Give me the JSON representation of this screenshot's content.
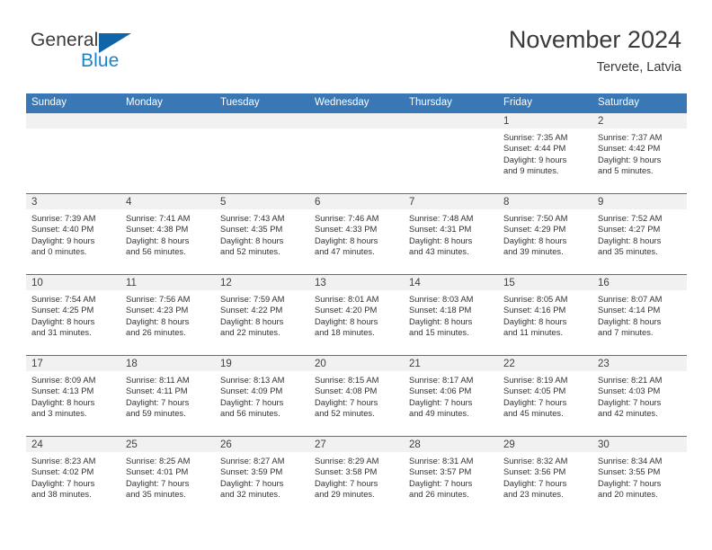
{
  "brand": {
    "word1": "General",
    "word2": "Blue",
    "triangle_icon": "brand-triangle-icon",
    "colors": {
      "word1": "#3c3c3c",
      "word2": "#1b84c9",
      "triangle": "#1064a8"
    }
  },
  "header": {
    "title": "November 2024",
    "subtitle": "Tervete, Latvia"
  },
  "colors": {
    "header_blue": "#3a77b5",
    "daynum_strip": "#f1f1f1",
    "text": "#333333"
  },
  "weekday_headers": [
    "Sunday",
    "Monday",
    "Tuesday",
    "Wednesday",
    "Thursday",
    "Friday",
    "Saturday"
  ],
  "weeks": [
    [
      {
        "day": "",
        "lines": []
      },
      {
        "day": "",
        "lines": []
      },
      {
        "day": "",
        "lines": []
      },
      {
        "day": "",
        "lines": []
      },
      {
        "day": "",
        "lines": []
      },
      {
        "day": "1",
        "lines": [
          "Sunrise: 7:35 AM",
          "Sunset: 4:44 PM",
          "Daylight: 9 hours",
          "and 9 minutes."
        ]
      },
      {
        "day": "2",
        "lines": [
          "Sunrise: 7:37 AM",
          "Sunset: 4:42 PM",
          "Daylight: 9 hours",
          "and 5 minutes."
        ]
      }
    ],
    [
      {
        "day": "3",
        "lines": [
          "Sunrise: 7:39 AM",
          "Sunset: 4:40 PM",
          "Daylight: 9 hours",
          "and 0 minutes."
        ]
      },
      {
        "day": "4",
        "lines": [
          "Sunrise: 7:41 AM",
          "Sunset: 4:38 PM",
          "Daylight: 8 hours",
          "and 56 minutes."
        ]
      },
      {
        "day": "5",
        "lines": [
          "Sunrise: 7:43 AM",
          "Sunset: 4:35 PM",
          "Daylight: 8 hours",
          "and 52 minutes."
        ]
      },
      {
        "day": "6",
        "lines": [
          "Sunrise: 7:46 AM",
          "Sunset: 4:33 PM",
          "Daylight: 8 hours",
          "and 47 minutes."
        ]
      },
      {
        "day": "7",
        "lines": [
          "Sunrise: 7:48 AM",
          "Sunset: 4:31 PM",
          "Daylight: 8 hours",
          "and 43 minutes."
        ]
      },
      {
        "day": "8",
        "lines": [
          "Sunrise: 7:50 AM",
          "Sunset: 4:29 PM",
          "Daylight: 8 hours",
          "and 39 minutes."
        ]
      },
      {
        "day": "9",
        "lines": [
          "Sunrise: 7:52 AM",
          "Sunset: 4:27 PM",
          "Daylight: 8 hours",
          "and 35 minutes."
        ]
      }
    ],
    [
      {
        "day": "10",
        "lines": [
          "Sunrise: 7:54 AM",
          "Sunset: 4:25 PM",
          "Daylight: 8 hours",
          "and 31 minutes."
        ]
      },
      {
        "day": "11",
        "lines": [
          "Sunrise: 7:56 AM",
          "Sunset: 4:23 PM",
          "Daylight: 8 hours",
          "and 26 minutes."
        ]
      },
      {
        "day": "12",
        "lines": [
          "Sunrise: 7:59 AM",
          "Sunset: 4:22 PM",
          "Daylight: 8 hours",
          "and 22 minutes."
        ]
      },
      {
        "day": "13",
        "lines": [
          "Sunrise: 8:01 AM",
          "Sunset: 4:20 PM",
          "Daylight: 8 hours",
          "and 18 minutes."
        ]
      },
      {
        "day": "14",
        "lines": [
          "Sunrise: 8:03 AM",
          "Sunset: 4:18 PM",
          "Daylight: 8 hours",
          "and 15 minutes."
        ]
      },
      {
        "day": "15",
        "lines": [
          "Sunrise: 8:05 AM",
          "Sunset: 4:16 PM",
          "Daylight: 8 hours",
          "and 11 minutes."
        ]
      },
      {
        "day": "16",
        "lines": [
          "Sunrise: 8:07 AM",
          "Sunset: 4:14 PM",
          "Daylight: 8 hours",
          "and 7 minutes."
        ]
      }
    ],
    [
      {
        "day": "17",
        "lines": [
          "Sunrise: 8:09 AM",
          "Sunset: 4:13 PM",
          "Daylight: 8 hours",
          "and 3 minutes."
        ]
      },
      {
        "day": "18",
        "lines": [
          "Sunrise: 8:11 AM",
          "Sunset: 4:11 PM",
          "Daylight: 7 hours",
          "and 59 minutes."
        ]
      },
      {
        "day": "19",
        "lines": [
          "Sunrise: 8:13 AM",
          "Sunset: 4:09 PM",
          "Daylight: 7 hours",
          "and 56 minutes."
        ]
      },
      {
        "day": "20",
        "lines": [
          "Sunrise: 8:15 AM",
          "Sunset: 4:08 PM",
          "Daylight: 7 hours",
          "and 52 minutes."
        ]
      },
      {
        "day": "21",
        "lines": [
          "Sunrise: 8:17 AM",
          "Sunset: 4:06 PM",
          "Daylight: 7 hours",
          "and 49 minutes."
        ]
      },
      {
        "day": "22",
        "lines": [
          "Sunrise: 8:19 AM",
          "Sunset: 4:05 PM",
          "Daylight: 7 hours",
          "and 45 minutes."
        ]
      },
      {
        "day": "23",
        "lines": [
          "Sunrise: 8:21 AM",
          "Sunset: 4:03 PM",
          "Daylight: 7 hours",
          "and 42 minutes."
        ]
      }
    ],
    [
      {
        "day": "24",
        "lines": [
          "Sunrise: 8:23 AM",
          "Sunset: 4:02 PM",
          "Daylight: 7 hours",
          "and 38 minutes."
        ]
      },
      {
        "day": "25",
        "lines": [
          "Sunrise: 8:25 AM",
          "Sunset: 4:01 PM",
          "Daylight: 7 hours",
          "and 35 minutes."
        ]
      },
      {
        "day": "26",
        "lines": [
          "Sunrise: 8:27 AM",
          "Sunset: 3:59 PM",
          "Daylight: 7 hours",
          "and 32 minutes."
        ]
      },
      {
        "day": "27",
        "lines": [
          "Sunrise: 8:29 AM",
          "Sunset: 3:58 PM",
          "Daylight: 7 hours",
          "and 29 minutes."
        ]
      },
      {
        "day": "28",
        "lines": [
          "Sunrise: 8:31 AM",
          "Sunset: 3:57 PM",
          "Daylight: 7 hours",
          "and 26 minutes."
        ]
      },
      {
        "day": "29",
        "lines": [
          "Sunrise: 8:32 AM",
          "Sunset: 3:56 PM",
          "Daylight: 7 hours",
          "and 23 minutes."
        ]
      },
      {
        "day": "30",
        "lines": [
          "Sunrise: 8:34 AM",
          "Sunset: 3:55 PM",
          "Daylight: 7 hours",
          "and 20 minutes."
        ]
      }
    ]
  ]
}
